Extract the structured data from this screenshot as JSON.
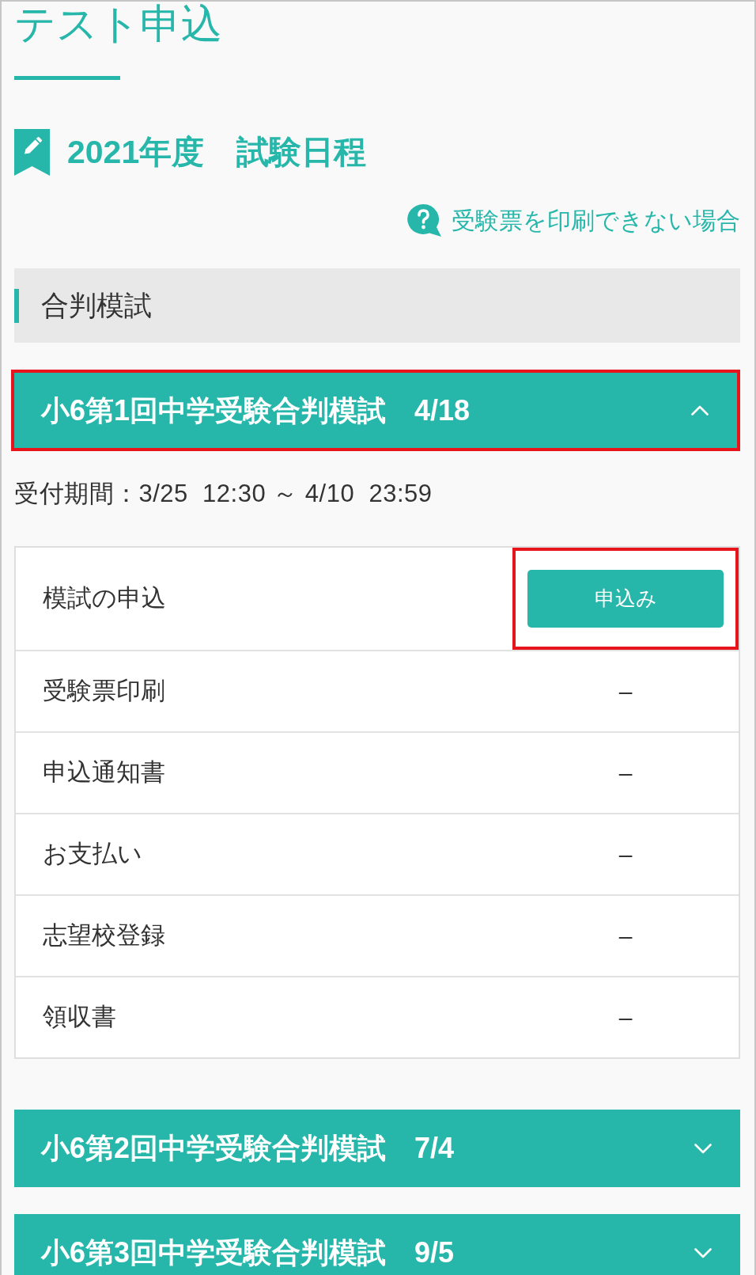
{
  "page": {
    "title": "テスト申込"
  },
  "schedule": {
    "heading": "2021年度　試験日程",
    "help_link": "受験票を印刷できない場合"
  },
  "category": {
    "label": "合判模試"
  },
  "exams": [
    {
      "title": "小6第1回中学受験合判模試　4/18",
      "expanded": true,
      "highlighted": true,
      "period": "受付期間：3/25  12:30 ～ 4/10  23:59",
      "steps": [
        {
          "kind": "button",
          "label": "模試の申込",
          "action": "申込み",
          "highlighted": true
        },
        {
          "kind": "status",
          "label": "受験票印刷",
          "status": "–",
          "highlighted": false
        },
        {
          "kind": "status",
          "label": "申込通知書",
          "status": "–",
          "highlighted": false
        },
        {
          "kind": "status",
          "label": "お支払い",
          "status": "–",
          "highlighted": false
        },
        {
          "kind": "status",
          "label": "志望校登録",
          "status": "–",
          "highlighted": false
        },
        {
          "kind": "status",
          "label": "領収書",
          "status": "–",
          "highlighted": false
        }
      ]
    },
    {
      "title": "小6第2回中学受験合判模試　7/4",
      "expanded": false,
      "highlighted": false
    },
    {
      "title": "小6第3回中学受験合判模試　9/5",
      "expanded": false,
      "highlighted": false
    }
  ]
}
